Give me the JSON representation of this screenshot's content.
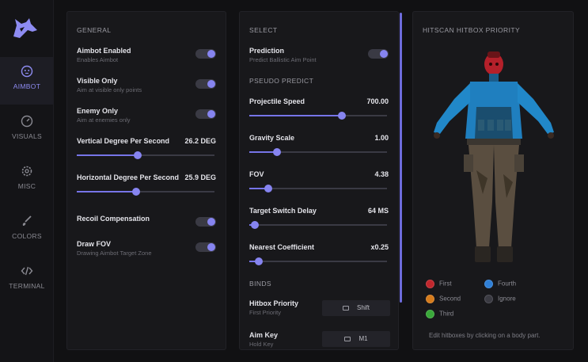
{
  "nav": [
    {
      "label": "AIMBOT",
      "icon": "aimbot-face-icon",
      "active": true
    },
    {
      "label": "VISUALS",
      "icon": "visuals-gauge-icon",
      "active": false
    },
    {
      "label": "MISC",
      "icon": "gear-icon",
      "active": false
    },
    {
      "label": "COLORS",
      "icon": "brush-icon",
      "active": false
    },
    {
      "label": "TERMINAL",
      "icon": "code-icon",
      "active": false
    }
  ],
  "general": {
    "title": "GENERAL",
    "aimbot_enabled": {
      "label": "Aimbot Enabled",
      "desc": "Enables Aimbot",
      "on": true
    },
    "visible_only": {
      "label": "Visible Only",
      "desc": "Aim at visible only points",
      "on": true
    },
    "enemy_only": {
      "label": "Enemy Only",
      "desc": "Aim at enemies only",
      "on": true
    },
    "vertical_degree": {
      "label": "Vertical Degree Per Second",
      "value": "26.2 DEG",
      "level": 0.44
    },
    "horizontal_degree": {
      "label": "Horizontal Degree Per Second",
      "value": "25.9 DEG",
      "level": 0.43
    },
    "recoil_compensation": {
      "label": "Recoil Compensation",
      "on": true
    },
    "draw_fov": {
      "label": "Draw FOV",
      "desc": "Drawing Aimbot Target Zone",
      "on": true
    }
  },
  "select": {
    "title": "SELECT",
    "prediction": {
      "label": "Prediction",
      "desc": "Predict Ballistic Aim Point",
      "on": true
    },
    "pseudo_title": "PSEUDO PREDICT",
    "projectile_speed": {
      "label": "Projectile Speed",
      "value": "700.00",
      "level": 0.67
    },
    "gravity_scale": {
      "label": "Gravity Scale",
      "value": "1.00",
      "level": 0.2
    },
    "fov": {
      "label": "FOV",
      "value": "4.38",
      "level": 0.14
    },
    "target_switch_delay": {
      "label": "Target Switch Delay",
      "value": "64 MS",
      "level": 0.04
    },
    "nearest_coefficient": {
      "label": "Nearest Coefficient",
      "value": "x0.25",
      "level": 0.07
    },
    "binds_title": "BINDS",
    "hitbox_priority": {
      "label": "Hitbox Priority",
      "desc": "First Priority",
      "key": "Shift"
    },
    "aim_key": {
      "label": "Aim Key",
      "desc": "Hold Key",
      "key": "M1"
    }
  },
  "hitbox": {
    "title": "HITSCAN HITBOX PRIORITY",
    "legend": [
      {
        "label": "First",
        "color": "#c0272d"
      },
      {
        "label": "Second",
        "color": "#d67c1c"
      },
      {
        "label": "Third",
        "color": "#3aa83a"
      },
      {
        "label": "Fourth",
        "color": "#2f7fd6"
      },
      {
        "label": "Ignore",
        "color": "#3a3a42"
      }
    ],
    "hint": "Edit hitboxes by clicking on a body part."
  }
}
